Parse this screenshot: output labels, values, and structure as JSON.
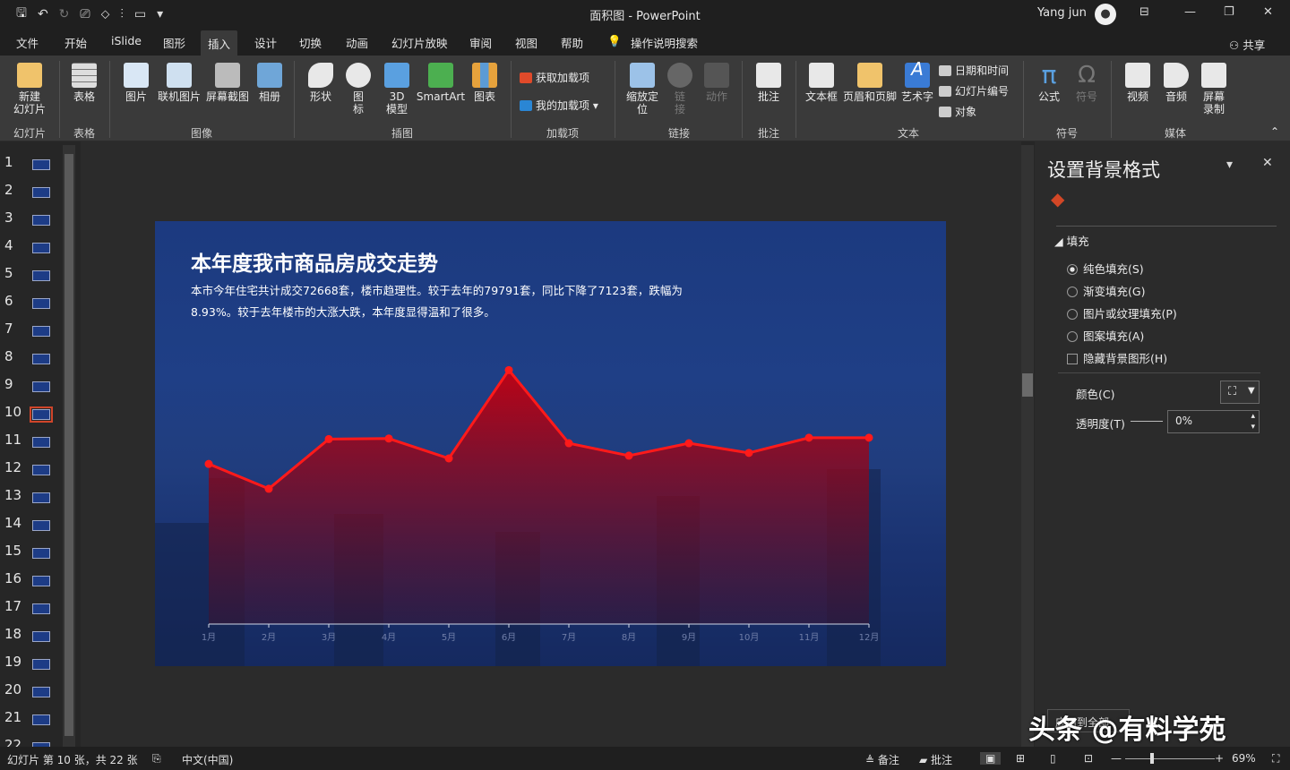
{
  "titlebar": {
    "doc_title": "面积图  -  PowerPoint",
    "user": "Yang jun"
  },
  "menu": {
    "tabs": [
      "文件",
      "开始",
      "iSlide",
      "图形",
      "插入",
      "设计",
      "切换",
      "动画",
      "幻灯片放映",
      "审阅",
      "视图",
      "帮助"
    ],
    "active": "插入",
    "search": "操作说明搜索",
    "share": "共享"
  },
  "ribbon": {
    "buttons": {
      "new_slide": "新建\n幻灯片",
      "table": "表格",
      "picture": "图片",
      "online_picture": "联机图片",
      "screenshot": "屏幕截图",
      "album": "相册",
      "shapes": "形状",
      "icons": "图\n标",
      "model3d": "3D\n模型",
      "smartart": "SmartArt",
      "chart": "图表",
      "get_addins": "获取加载项",
      "my_addins": "我的加载项",
      "zoom": "缩放定\n位",
      "link": "链\n接",
      "action": "动作",
      "comment": "批注",
      "textbox": "文本框",
      "header_footer": "页眉和页脚",
      "wordart": "艺术字",
      "date_time": "日期和时间",
      "slide_number": "幻灯片编号",
      "object": "对象",
      "equation": "公式",
      "symbol": "符号",
      "video": "视频",
      "audio": "音频",
      "screen_record": "屏幕\n录制"
    },
    "groups": {
      "slides": "幻灯片",
      "tables": "表格",
      "images": "图像",
      "illustrations": "插图",
      "addins": "加载项",
      "links": "链接",
      "comments": "批注",
      "text": "文本",
      "symbols": "符号",
      "media": "媒体"
    }
  },
  "thumbnails": {
    "numbers": [
      "1",
      "2",
      "3",
      "4",
      "5",
      "6",
      "7",
      "8",
      "9",
      "10",
      "11",
      "12",
      "13",
      "14",
      "15",
      "16",
      "17",
      "18",
      "19",
      "20",
      "21",
      "22"
    ],
    "selected": "10"
  },
  "slide": {
    "title": "本年度我市商品房成交走势",
    "body": "本市今年住宅共计成交72668套，楼市趋理性。较于去年的79791套，同比下降了7123套，跌幅为8.93%。较于去年楼市的大涨大跌，本年度显得温和了很多。"
  },
  "chart_data": {
    "type": "area",
    "categories": [
      "1月",
      "2月",
      "3月",
      "4月",
      "5月",
      "6月",
      "7月",
      "8月",
      "9月",
      "10月",
      "11月",
      "12月"
    ],
    "series": [
      {
        "values": [
          5800,
          4900,
          6700,
          6720,
          6000,
          9200,
          6550,
          6100,
          6550,
          6200,
          6750,
          6750
        ]
      }
    ],
    "ylim": [
      0,
      12000
    ],
    "colors": {
      "line": "#ff1a1a",
      "area_top": "#c40010",
      "area_bottom": "#3a1230"
    }
  },
  "pane": {
    "title": "设置背景格式",
    "section": "填充",
    "options": [
      "纯色填充(S)",
      "渐变填充(G)",
      "图片或纹理填充(P)",
      "图案填充(A)"
    ],
    "selected": "纯色填充(S)",
    "hide_bg": "隐藏背景图形(H)",
    "color_label": "颜色(C)",
    "transparency_label": "透明度(T)",
    "transparency": "0%",
    "apply_label": "应用到全部"
  },
  "status": {
    "slide_info": "幻灯片 第 10 张，共 22 张",
    "language": "中文(中国)",
    "notes": "备注",
    "comments": "批注",
    "zoom": "69%"
  },
  "watermark": "头条 @有料学苑"
}
